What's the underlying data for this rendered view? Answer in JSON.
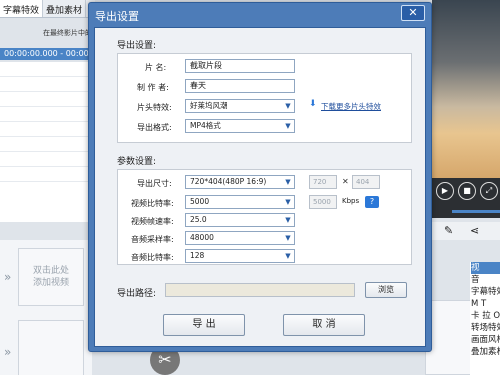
{
  "background": {
    "tabs": [
      "字幕特效",
      "叠加素材"
    ],
    "hint_text": "在最终影片中的",
    "timecode": "00:00:00.000 - 00:00:",
    "thumbnail_text": [
      "双击此处",
      "添加视频"
    ],
    "side_list": [
      "视",
      "音",
      "字幕特效",
      "M T",
      "卡 拉 O",
      "转场特效",
      "画面风格",
      "叠加素材"
    ]
  },
  "dialog": {
    "title": "导出设置",
    "export_settings_label": "导出设置:",
    "title_field_label": "片    名:",
    "title_value": "截取片段",
    "author_label": "制 作 者:",
    "author_value": "春天",
    "opening_effect_label": "片头特效:",
    "opening_effect_value": "好莱坞风潮",
    "download_link": "下载更多片头特效",
    "format_label": "导出格式:",
    "format_value": "MP4格式",
    "params_label": "参数设置:",
    "size_label": "导出尺寸:",
    "size_value": "720*404(480P 16:9)",
    "width_value": "720",
    "height_value": "404",
    "video_bitrate_label": "视频比特率:",
    "video_bitrate_value": "5000",
    "video_bitrate_custom": "5000",
    "bitrate_unit": "Kbps",
    "help_label": "?",
    "frame_rate_label": "视频帧速率:",
    "frame_rate_value": "25.0",
    "audio_sample_label": "音频采样率:",
    "audio_sample_value": "48000",
    "audio_bitrate_label": "音频比特率:",
    "audio_bitrate_value": "128",
    "path_label": "导出路径:",
    "browse_label": "浏览",
    "export_button": "导 出",
    "cancel_button": "取 消",
    "close_glyph": "✕"
  },
  "colors": {
    "dialog_frame": "#4d7cb8",
    "accent_blue": "#2b78d8",
    "timecode_highlight": "#4a84c6"
  }
}
